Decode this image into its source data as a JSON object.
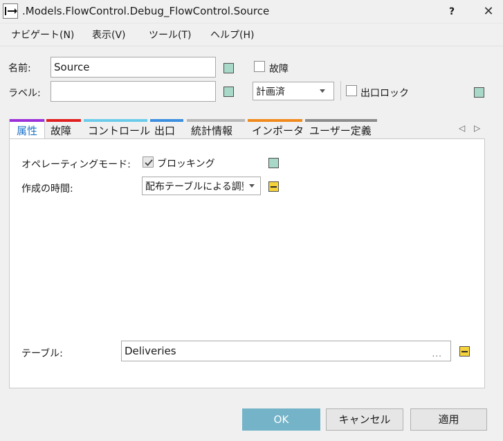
{
  "window": {
    "title": ".Models.FlowControl.Debug_FlowControl.Source",
    "help": "?",
    "close": "✕"
  },
  "menu": {
    "items": [
      "ナビゲート(N)",
      "表示(V)",
      "ツール(T)",
      "ヘルプ(H)"
    ]
  },
  "form": {
    "name_label": "名前:",
    "name_value": "Source",
    "label_label": "ラベル:",
    "label_value": "",
    "failure_label": "故障",
    "failure_checked": false,
    "planned_value": "計画済",
    "exit_lock_label": "出口ロック",
    "exit_lock_checked": false
  },
  "tabs": {
    "active": "属性",
    "items": [
      {
        "label": "属性",
        "color": "#9b30d9"
      },
      {
        "label": "故障",
        "color": "#e01f1f"
      },
      {
        "label": "コントロール",
        "color": "#6ccbea"
      },
      {
        "label": "出口",
        "color": "#3d8fe0"
      },
      {
        "label": "統計情報",
        "color": "#b8b8b8"
      },
      {
        "label": "インポータ",
        "color": "#f08a1e"
      },
      {
        "label": "ユーザー定義",
        "color": "#8c8c8c"
      }
    ],
    "nav_left": "◁",
    "nav_right": "▷"
  },
  "attributes": {
    "operating_mode_label": "オペレーティングモード:",
    "blocking_label": "ブロッキング",
    "blocking_checked": true,
    "creation_time_label": "作成の時間:",
    "creation_time_value": "配布テーブルによる調整",
    "table_label": "テーブル:",
    "table_value": "Deliveries",
    "table_browse": "..."
  },
  "buttons": {
    "ok": "OK",
    "cancel": "キャンセル",
    "apply": "適用"
  },
  "colors": {
    "swatch_green": "#a8d8c8",
    "swatch_yellow": "#f5d23c",
    "primary": "#74b3c8",
    "active_tab_text": "#1a73c8"
  }
}
